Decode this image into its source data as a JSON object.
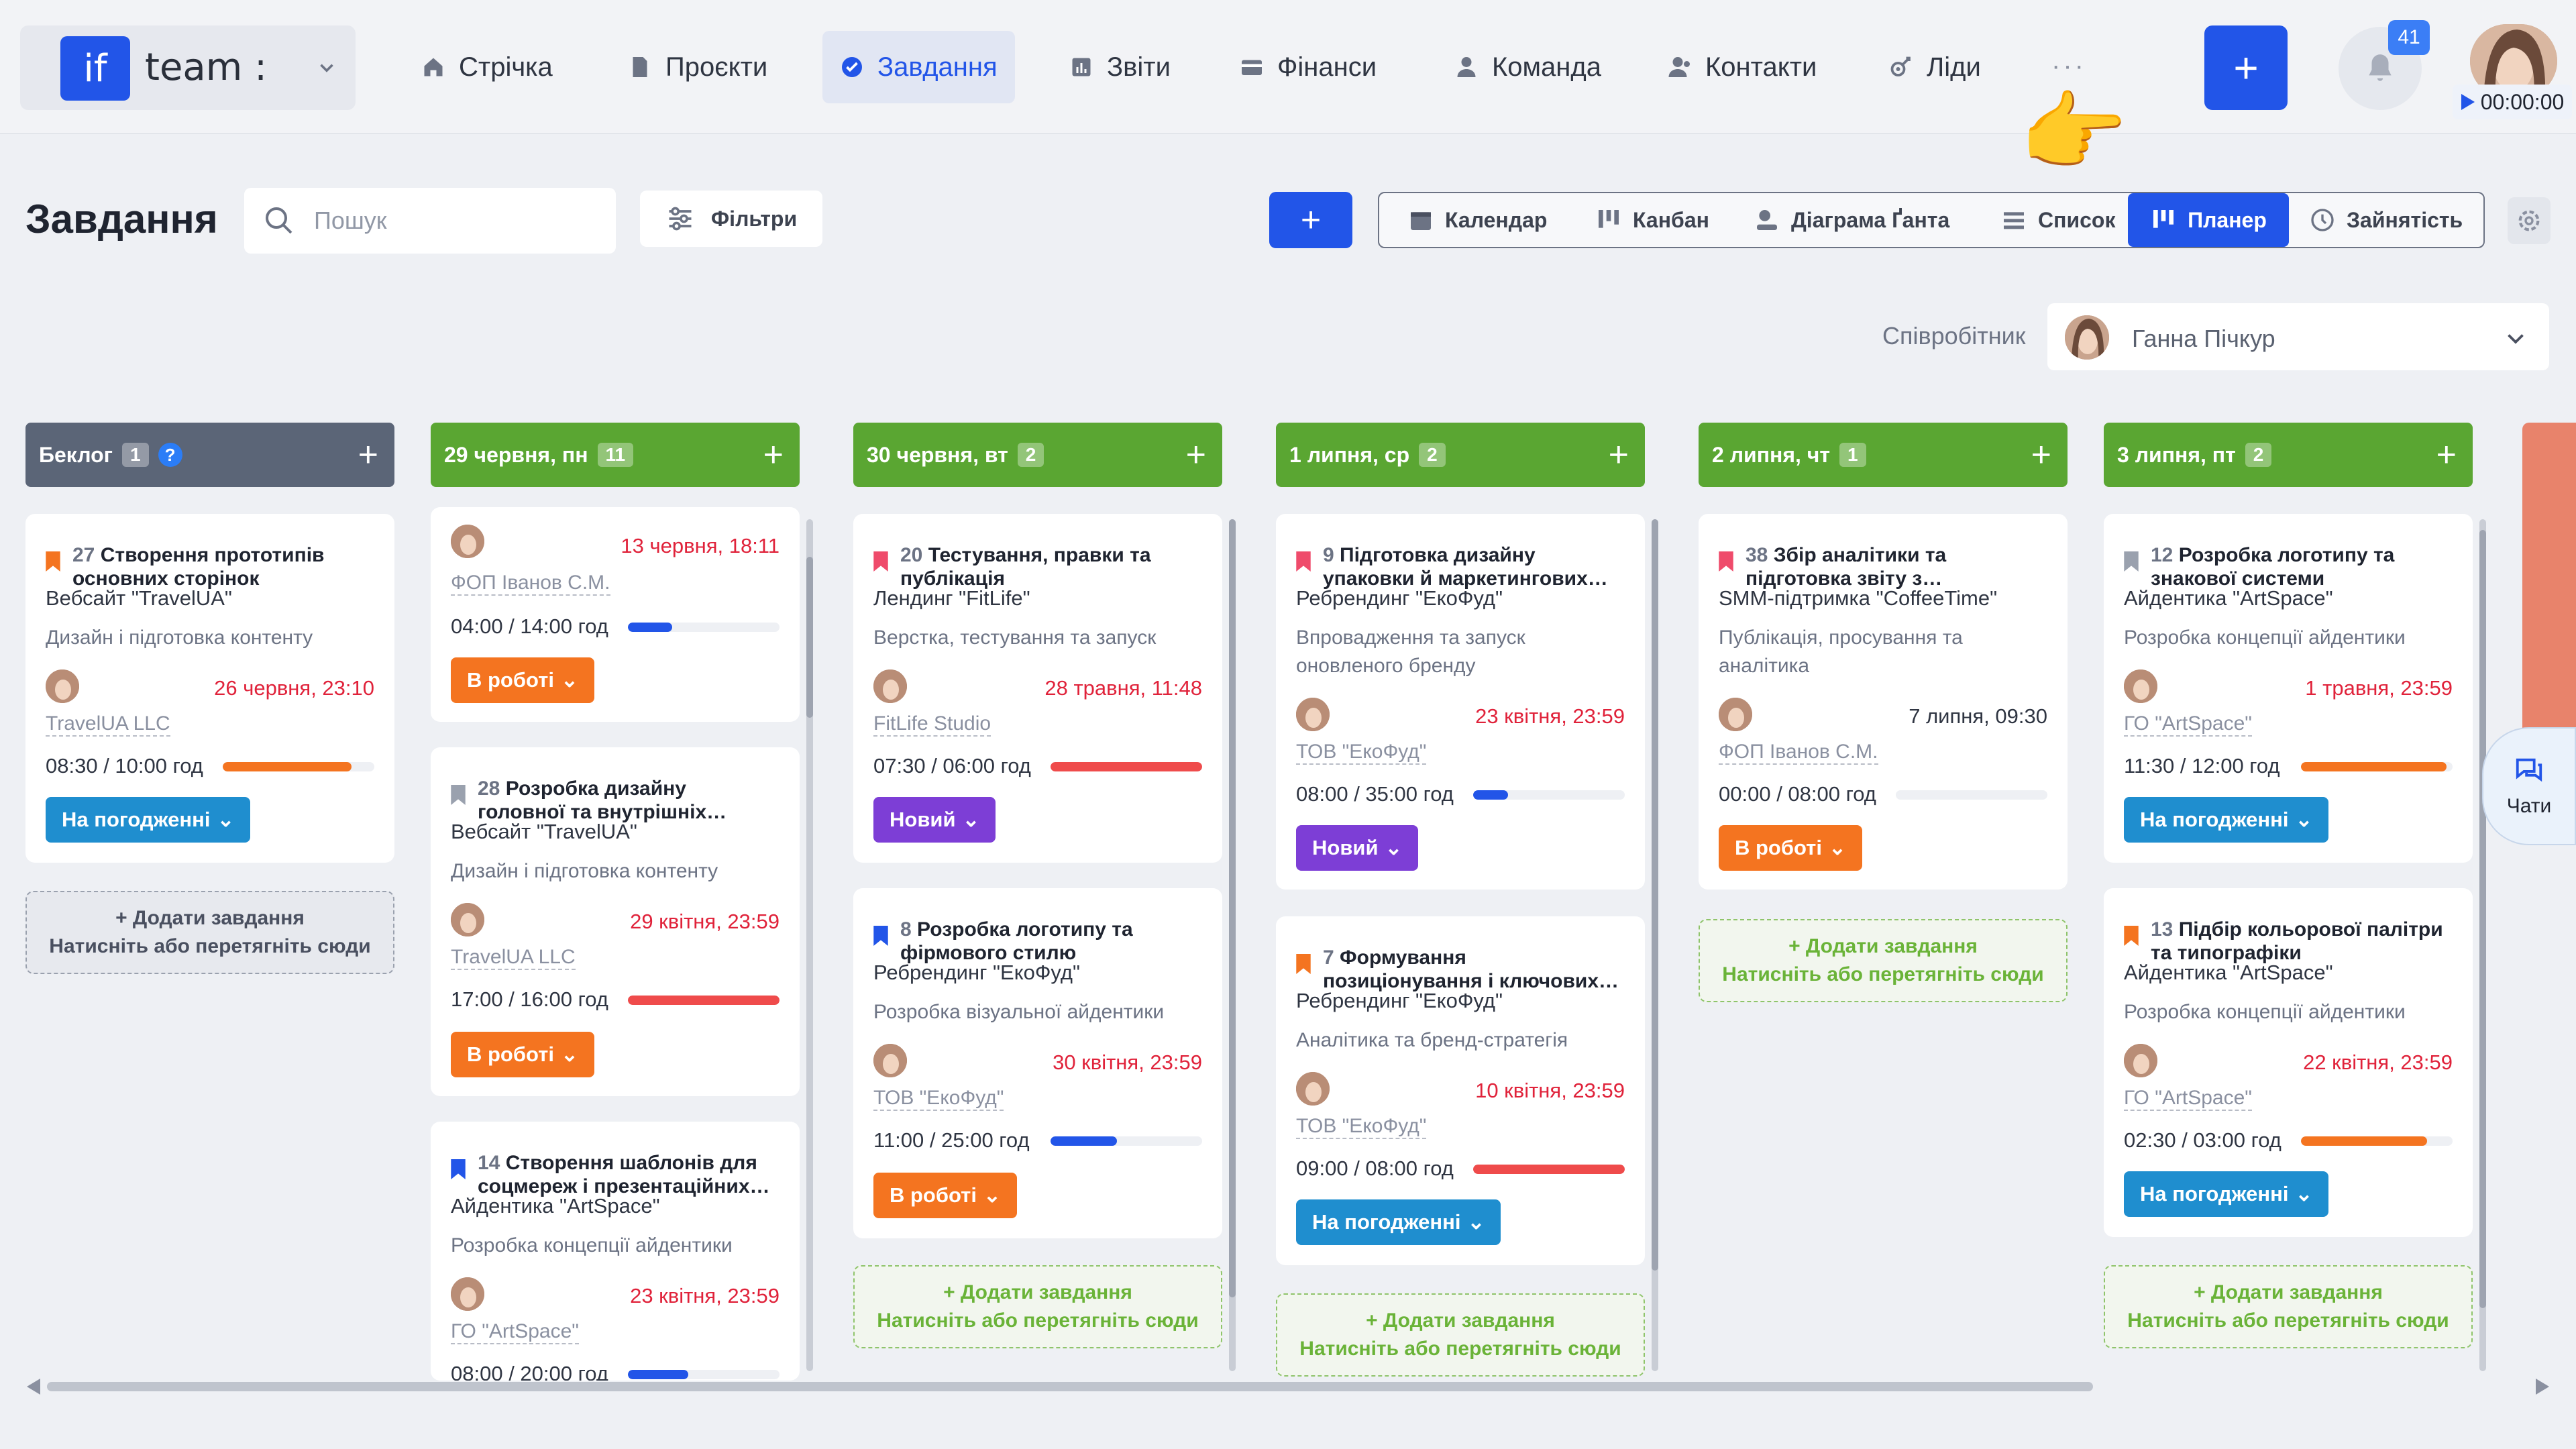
{
  "header": {
    "logo_mark": "if",
    "logo_text": "team :",
    "nav": [
      {
        "label": "Стрічка",
        "icon": "home-icon"
      },
      {
        "label": "Проєкти",
        "icon": "document-icon"
      },
      {
        "label": "Завдання",
        "icon": "check-circle-icon",
        "active": true
      },
      {
        "label": "Звіти",
        "icon": "report-icon"
      },
      {
        "label": "Фінанси",
        "icon": "wallet-icon"
      },
      {
        "label": "Команда",
        "icon": "person-icon"
      },
      {
        "label": "Контакти",
        "icon": "contacts-icon"
      },
      {
        "label": "Ліди",
        "icon": "leads-icon"
      }
    ],
    "more": "···",
    "add_label": "+",
    "notifications_count": "41",
    "timer": "00:00:00"
  },
  "toolbar": {
    "title": "Завдання",
    "search_placeholder": "Пошук",
    "filters_label": "Фільтри",
    "add_label": "+",
    "views": [
      {
        "label": "Календар",
        "icon": "calendar-icon"
      },
      {
        "label": "Канбан",
        "icon": "kanban-icon"
      },
      {
        "label": "Діаграма Ґанта",
        "icon": "gantt-icon"
      },
      {
        "label": "Список",
        "icon": "list-icon"
      },
      {
        "label": "Планер",
        "icon": "planner-icon",
        "active": true
      },
      {
        "label": "Зайнятість",
        "icon": "clock-icon"
      }
    ],
    "employee_label": "Співробітник",
    "employee_name": "Ганна Пічкур"
  },
  "columns": [
    {
      "title": "Беклог",
      "count": "1",
      "color": "#5b6577",
      "help": "?"
    },
    {
      "title": "29 червня, пн",
      "count": "11",
      "color": "#5aa632"
    },
    {
      "title": "30 червня, вт",
      "count": "2",
      "color": "#5aa632"
    },
    {
      "title": "1 липня, ср",
      "count": "2",
      "color": "#5aa632"
    },
    {
      "title": "2 липня, чт",
      "count": "1",
      "color": "#5aa632"
    },
    {
      "title": "3 липня, пт",
      "count": "2",
      "color": "#5aa632"
    }
  ],
  "add_task": {
    "line1": "+ Додати завдання",
    "line2": "Натисніть або перетягніть сюди"
  },
  "cards": {
    "c27": {
      "num": "27",
      "title1": "Створення прототипів",
      "title2": "основних сторінок",
      "project": "Вебсайт \"TravelUA\"",
      "stage": "Дизайн і підготовка контенту",
      "due": "26 червня, 23:10",
      "client": "TravelUA LLC",
      "hours": "08:30 / 10:00 год",
      "progress": 0.85,
      "bar_color": "#f47420",
      "status": "На погодженні",
      "flag_color": "#f47420"
    },
    "cpart": {
      "due": "13 червня, 18:11",
      "client": "ФОП Іванов С.М.",
      "hours": "04:00 / 14:00 год",
      "progress": 0.29,
      "bar_color": "#2255e8",
      "status": "В роботі"
    },
    "c28": {
      "num": "28",
      "title1": "Розробка дизайну",
      "title2": "головної та внутрішніх…",
      "project": "Вебсайт \"TravelUA\"",
      "stage": "Дизайн і підготовка контенту",
      "due": "29 квітня, 23:59",
      "client": "TravelUA LLC",
      "hours": "17:00 / 16:00 год",
      "progress": 1,
      "bar_color": "#ef4b4b",
      "status": "В роботі",
      "flag_color": "#9aa1ae"
    },
    "c14": {
      "num": "14",
      "title1": "Створення шаблонів для",
      "title2": "соцмереж і презентаційних…",
      "project": "Айдентика \"ArtSpace\"",
      "stage": "Розробка концепції айдентики",
      "due": "23 квітня, 23:59",
      "client": "ГО \"ArtSpace\"",
      "hours": "08:00 / 20:00 год",
      "progress": 0.4,
      "bar_color": "#2255e8",
      "flag_color": "#2255e8"
    },
    "c20": {
      "num": "20",
      "title1": "Тестування, правки та",
      "title2": "публікація",
      "project": "Лендинг \"FitLife\"",
      "stage": "Верстка, тестування та запуск",
      "due": "28 травня, 11:48",
      "client": "FitLife Studio",
      "hours": "07:30 / 06:00 год",
      "progress": 1,
      "bar_color": "#ef4b4b",
      "status": "Новий",
      "flag_color": "#ef4b6b"
    },
    "c8": {
      "num": "8",
      "title1": "Розробка логотипу та",
      "title2": "фірмового стилю",
      "project": "Ребрендинг \"ЕкоФуд\"",
      "stage": "Розробка візуальної айдентики",
      "due": "30 квітня, 23:59",
      "client": "ТОВ \"ЕкоФуд\"",
      "hours": "11:00 / 25:00 год",
      "progress": 0.44,
      "bar_color": "#2255e8",
      "status": "В роботі",
      "flag_color": "#2255e8"
    },
    "c9": {
      "num": "9",
      "title1": "Підготовка дизайну",
      "title2": "упаковки й маркетингових…",
      "project": "Ребрендинг \"ЕкоФуд\"",
      "stage": "Впровадження та запуск оновленого бренду",
      "due": "23 квітня, 23:59",
      "client": "ТОВ \"ЕкоФуд\"",
      "hours": "08:00 / 35:00 год",
      "progress": 0.23,
      "bar_color": "#2255e8",
      "status": "Новий",
      "flag_color": "#ef4b6b"
    },
    "c7": {
      "num": "7",
      "title1": "Формування",
      "title2": "позиціонування і ключових…",
      "project": "Ребрендинг \"ЕкоФуд\"",
      "stage": "Аналітика та бренд-стратегія",
      "due": "10 квітня, 23:59",
      "client": "ТОВ \"ЕкоФуд\"",
      "hours": "09:00 / 08:00 год",
      "progress": 1,
      "bar_color": "#ef4b4b",
      "status": "На погодженні",
      "flag_color": "#f47420"
    },
    "c38": {
      "num": "38",
      "title1": "Збір аналітики та",
      "title2": "підготовка звіту з…",
      "project": "SMM-підтримка \"CoffeeTime\"",
      "stage": "Публікація, просування та аналітика",
      "due": "7 липня, 09:30",
      "client": "ФОП Іванов С.М.",
      "hours": "00:00 / 08:00 год",
      "progress": 0,
      "bar_color": "#2255e8",
      "status": "В роботі",
      "flag_color": "#ef4b6b"
    },
    "c12": {
      "num": "12",
      "title1": "Розробка логотипу та",
      "title2": "знакової системи",
      "project": "Айдентика \"ArtSpace\"",
      "stage": "Розробка концепції айдентики",
      "due": "1 травня, 23:59",
      "client": "ГО \"ArtSpace\"",
      "hours": "11:30 / 12:00 год",
      "progress": 0.96,
      "bar_color": "#f47420",
      "status": "На погодженні",
      "flag_color": "#9aa1ae"
    },
    "c13": {
      "num": "13",
      "title1": "Підбір кольорової палітри",
      "title2": "та типографіки",
      "project": "Айдентика \"ArtSpace\"",
      "stage": "Розробка концепції айдентики",
      "due": "22 квітня, 23:59",
      "client": "ГО \"ArtSpace\"",
      "hours": "02:30 / 03:00 год",
      "progress": 0.83,
      "bar_color": "#f47420",
      "status": "На погодженні",
      "flag_color": "#f47420"
    }
  },
  "chats_label": "Чати"
}
